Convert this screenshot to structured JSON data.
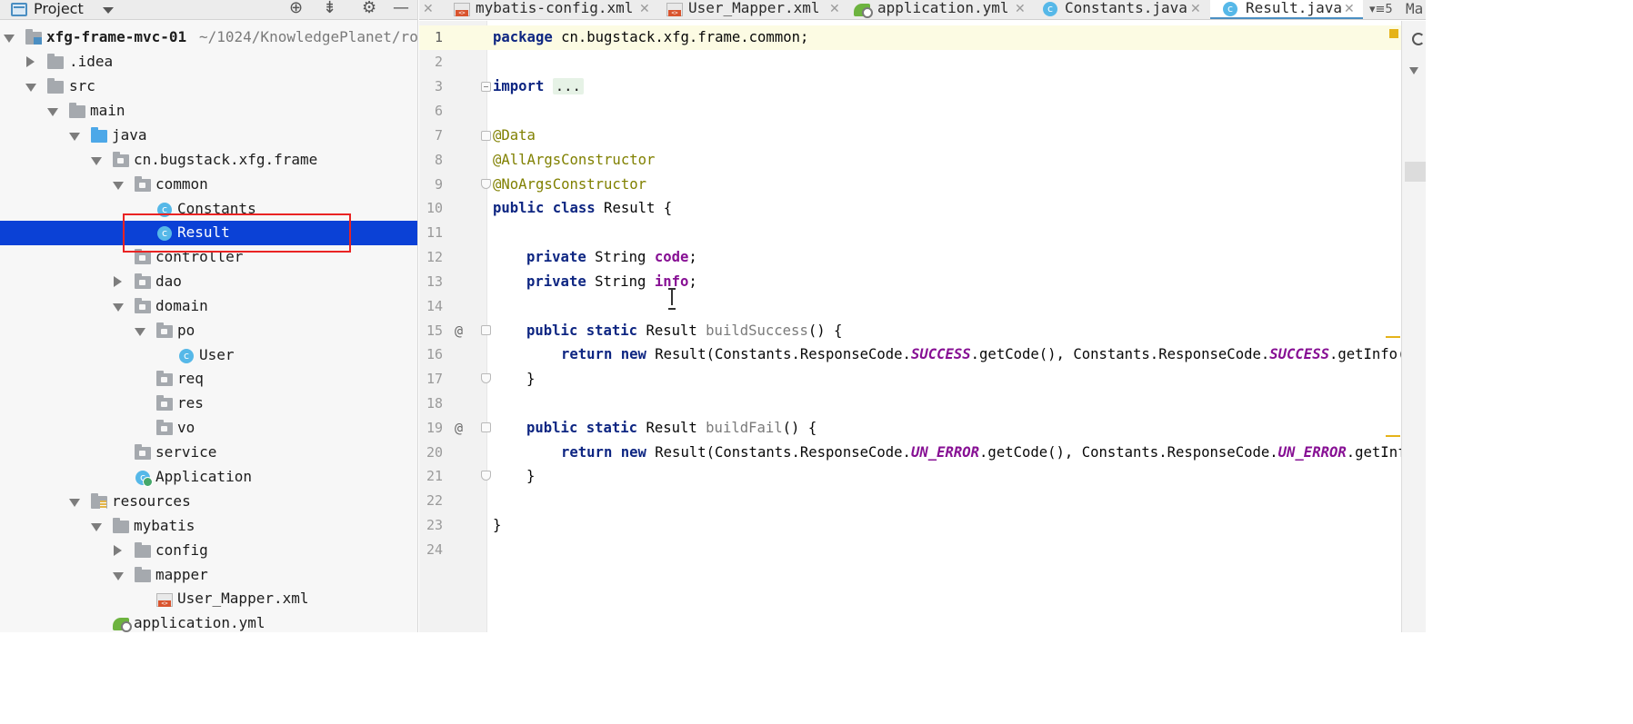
{
  "project_panel": {
    "title": "Project",
    "module_name": "xfg-frame-mvc-01",
    "module_path": "~/1024/KnowledgePlanet/roa",
    "items": [
      {
        "label": ".idea"
      },
      {
        "label": "src"
      },
      {
        "label": "main"
      },
      {
        "label": "java"
      },
      {
        "label": "cn.bugstack.xfg.frame"
      },
      {
        "label": "common"
      },
      {
        "label": "Constants"
      },
      {
        "label": "Result"
      },
      {
        "label": "controller"
      },
      {
        "label": "dao"
      },
      {
        "label": "domain"
      },
      {
        "label": "po"
      },
      {
        "label": "User"
      },
      {
        "label": "req"
      },
      {
        "label": "res"
      },
      {
        "label": "vo"
      },
      {
        "label": "service"
      },
      {
        "label": "Application"
      },
      {
        "label": "resources"
      },
      {
        "label": "mybatis"
      },
      {
        "label": "config"
      },
      {
        "label": "mapper"
      },
      {
        "label": "User_Mapper.xml"
      },
      {
        "label": "application.yml"
      }
    ]
  },
  "tabs": [
    {
      "label": "mybatis-config.xml",
      "icon": "xml-file-icon"
    },
    {
      "label": "User_Mapper.xml",
      "icon": "xml-file-icon"
    },
    {
      "label": "application.yml",
      "icon": "yaml-file-icon"
    },
    {
      "label": "Constants.java",
      "icon": "class-icon"
    },
    {
      "label": "Result.java",
      "icon": "class-icon",
      "active": true
    }
  ],
  "tab_overflow_count": "5",
  "tab_extra_label": "Ma",
  "editor": {
    "line_numbers": [
      "1",
      "2",
      "3",
      "6",
      "7",
      "8",
      "9",
      "10",
      "11",
      "12",
      "13",
      "14",
      "15",
      "16",
      "17",
      "18",
      "19",
      "20",
      "21",
      "22",
      "23",
      "24"
    ],
    "lines": {
      "l1_kw": "package",
      "l1_rest": " cn.bugstack.xfg.frame.common;",
      "l3_kw": "import",
      "l3_fold": "...",
      "l7": "@Data",
      "l8": "@AllArgsConstructor",
      "l9": "@NoArgsConstructor",
      "l10_kw": "public class",
      "l10_rest": " Result {",
      "l12_kw": "private",
      "l12_type": " String ",
      "l12_field": "code",
      "l12_end": ";",
      "l13_kw": "private",
      "l13_type": " String ",
      "l13_field": "info",
      "l13_end": ";",
      "l15_kw": "public static",
      "l15_type": " Result ",
      "l15_name": "buildSuccess",
      "l15_end": "() {",
      "l16_kw": "return new",
      "l16_a": " Result(Constants.ResponseCode.",
      "l16_c1": "SUCCESS",
      "l16_b": ".getCode(), Constants.ResponseCode.",
      "l16_c2": "SUCCESS",
      "l16_end": ".getInfo(",
      "l17": "}",
      "l19_kw": "public static",
      "l19_type": " Result ",
      "l19_name": "buildFail",
      "l19_end": "() {",
      "l20_kw": "return new",
      "l20_a": " Result(Constants.ResponseCode.",
      "l20_c1": "UN_ERROR",
      "l20_b": ".getCode(), Constants.ResponseCode.",
      "l20_c2": "UN_ERROR",
      "l20_end": ".getInf",
      "l21": "}",
      "l23": "}"
    },
    "gutter_marks": [
      "@",
      "@"
    ]
  }
}
